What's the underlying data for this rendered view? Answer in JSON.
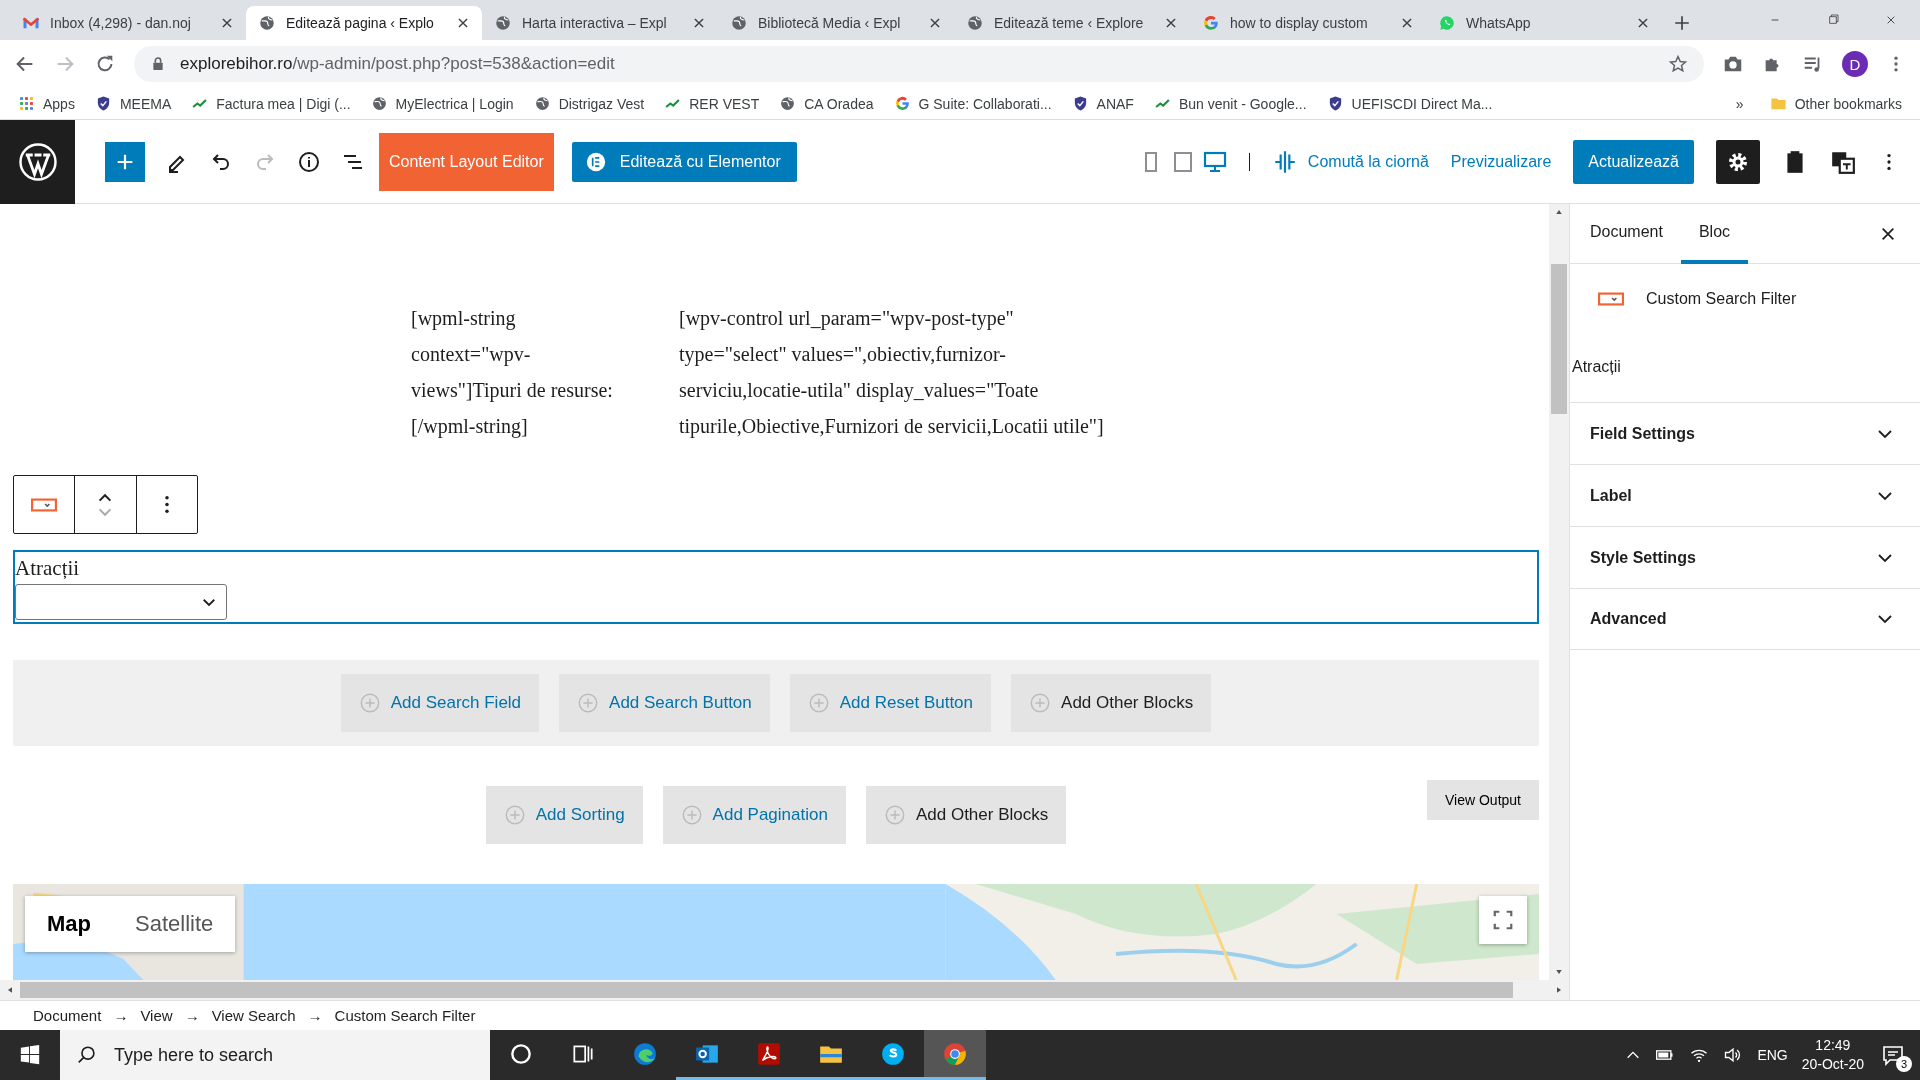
{
  "browser": {
    "tabs": [
      {
        "kind": "gmail",
        "title": "Inbox (4,298) - dan.noj",
        "selected": false
      },
      {
        "kind": "wordpress",
        "title": "Editează pagina ‹ Explo",
        "selected": true
      },
      {
        "kind": "wordpress",
        "title": "Harta interactiva – Expl",
        "selected": false
      },
      {
        "kind": "wordpress",
        "title": "Bibliotecă Media ‹ Expl",
        "selected": false
      },
      {
        "kind": "wordpress",
        "title": "Editează teme ‹ Explore",
        "selected": false
      },
      {
        "kind": "google",
        "title": "how to display custom",
        "selected": false
      },
      {
        "kind": "whatsapp",
        "title": "WhatsApp",
        "selected": false
      }
    ],
    "url_host": "explorebihor.ro",
    "url_path": "/wp-admin/post.php?post=538&action=edit",
    "profile_initial": "D",
    "bookmarks": [
      {
        "kind": "apps",
        "label": "Apps"
      },
      {
        "kind": "shield",
        "label": "MEEMA"
      },
      {
        "kind": "site",
        "label": "Factura mea | Digi (..."
      },
      {
        "kind": "globe",
        "label": "MyElectrica | Login"
      },
      {
        "kind": "globe",
        "label": "Distrigaz Vest"
      },
      {
        "kind": "site",
        "label": "RER VEST"
      },
      {
        "kind": "globe",
        "label": "CA Oradea"
      },
      {
        "kind": "google",
        "label": "G Suite: Collaborati..."
      },
      {
        "kind": "shield",
        "label": "ANAF"
      },
      {
        "kind": "site",
        "label": "Bun venit - Google..."
      },
      {
        "kind": "shield",
        "label": "UEFISCDI Direct Ma..."
      }
    ],
    "more": "»",
    "other_bookmarks": "Other bookmarks"
  },
  "editor": {
    "content_layout_button": "Content Layout Editor",
    "elementor_button": "Editează cu Elementor",
    "draft_link": "Comută la ciornă",
    "preview_link": "Previzualizare",
    "update_button": "Actualizează",
    "devices": [
      {
        "kind": "mobile",
        "selected": false
      },
      {
        "kind": "tablet",
        "selected": false
      },
      {
        "kind": "desktop",
        "selected": true
      }
    ]
  },
  "canvas": {
    "shortcodes": [
      "[wpml-string context=\"wpv-views\"]Tipuri de resurse:[/wpml-string]",
      "[wpv-control url_param=\"wpv-post-type\" type=\"select\" values=\",obiectiv,furnizor-serviciu,locatie-utila\" display_values=\"Toate tipurile,Obiective,Furnizori de servicii,Locatii utile\"]"
    ],
    "block_label": "Atracții",
    "search_row": [
      {
        "kind": "link",
        "label": "Add Search Field"
      },
      {
        "kind": "link",
        "label": "Add Search Button"
      },
      {
        "kind": "link",
        "label": "Add Reset Button"
      },
      {
        "kind": "plain",
        "label": "Add Other Blocks"
      }
    ],
    "output_row": [
      {
        "kind": "link",
        "label": "Add Sorting"
      },
      {
        "kind": "link",
        "label": "Add Pagination"
      },
      {
        "kind": "plain",
        "label": "Add Other Blocks"
      }
    ],
    "view_output": "View Output",
    "map": {
      "types": [
        {
          "label": "Map",
          "selected": true
        },
        {
          "label": "Satellite",
          "selected": false
        }
      ]
    }
  },
  "sidebar": {
    "tabs": [
      {
        "label": "Document",
        "selected": false
      },
      {
        "label": "Bloc",
        "selected": true
      }
    ],
    "block_title": "Custom Search Filter",
    "field_label": "Atracții",
    "panels": [
      {
        "title": "Field Settings",
        "expanded": false
      },
      {
        "title": "Label",
        "expanded": false
      },
      {
        "title": "Style Settings",
        "expanded": false
      },
      {
        "title": "Advanced",
        "expanded": false
      }
    ]
  },
  "breadcrumb": {
    "items": [
      "Document",
      "View",
      "View Search",
      "Custom Search Filter"
    ],
    "separator": "→"
  },
  "taskbar": {
    "search_placeholder": "Type here to search",
    "apps": [
      {
        "kind": "cortana",
        "running": false,
        "selected": false
      },
      {
        "kind": "taskview",
        "running": false,
        "selected": false
      },
      {
        "kind": "edge",
        "running": false,
        "selected": false
      },
      {
        "kind": "outlook",
        "running": true,
        "selected": false
      },
      {
        "kind": "acrobat",
        "running": true,
        "selected": false
      },
      {
        "kind": "explorer",
        "running": true,
        "selected": false
      },
      {
        "kind": "skype",
        "running": true,
        "selected": false
      },
      {
        "kind": "chrome",
        "running": true,
        "selected": true
      }
    ],
    "language": "ENG",
    "time": "12:49",
    "date": "20-Oct-20",
    "notifications": "3"
  }
}
